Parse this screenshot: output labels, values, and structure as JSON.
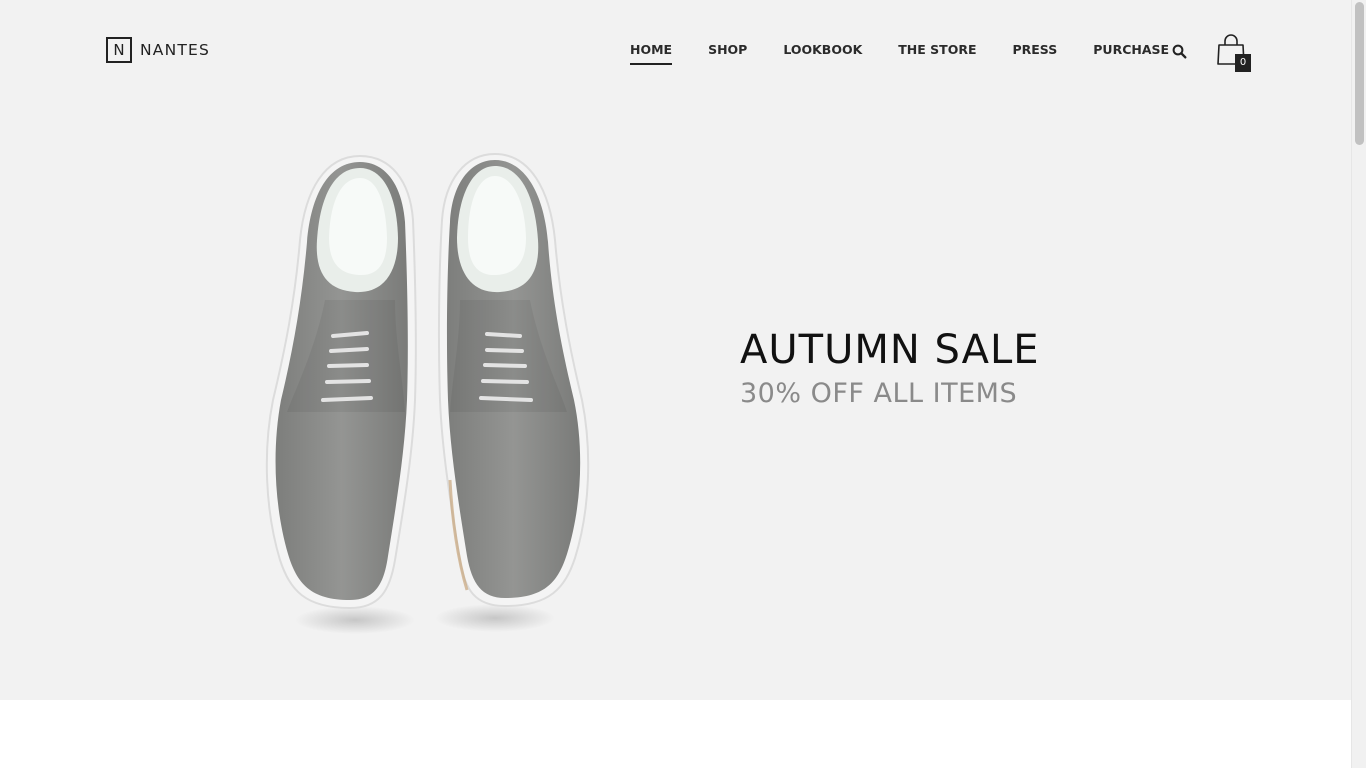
{
  "brand": {
    "logo_letter": "N",
    "name": "NANTES"
  },
  "nav": {
    "items": [
      {
        "label": "HOME",
        "active": true
      },
      {
        "label": "SHOP"
      },
      {
        "label": "LOOKBOOK"
      },
      {
        "label": "THE STORE"
      },
      {
        "label": "PRESS"
      },
      {
        "label": "PURCHASE"
      }
    ],
    "search_icon": "search-icon",
    "cart_icon": "shopping-bag-icon",
    "cart_count": "0"
  },
  "hero": {
    "title": "AUTUMN SALE",
    "subtitle": "30% OFF ALL ITEMS",
    "image": "grey-lace-up-shoes-image"
  },
  "colors": {
    "background": "#f2f2f2",
    "text": "#1a1a1a",
    "subtitle": "#8a8a8a",
    "badge": "#222222"
  }
}
